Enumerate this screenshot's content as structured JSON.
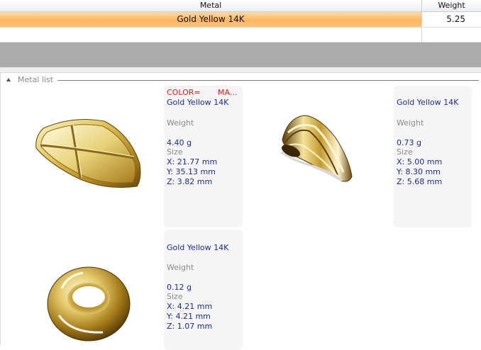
{
  "grid": {
    "columns": {
      "metal": "Metal",
      "weight": "Weight"
    },
    "selected_row": {
      "metal": "Gold Yellow 14K",
      "weight": "5.25"
    }
  },
  "metal_list": {
    "title": "Metal list",
    "items": [
      {
        "header_label": "COLOR=",
        "header_value": "MA...",
        "metal": "Gold Yellow 14K",
        "weight_label": "Weight",
        "weight": "4.40 g",
        "size_label": "Size",
        "x": "X: 21.77 mm",
        "y": "Y: 35.13 mm",
        "z": "Z: 3.82 mm",
        "thumbnail_icon": "shield-icon"
      },
      {
        "metal": "Gold Yellow 14K",
        "weight_label": "Weight",
        "weight": "0.73 g",
        "size_label": "Size",
        "x": "X: 5.00 mm",
        "y": "Y: 8.30 mm",
        "z": "Z: 5.68 mm",
        "thumbnail_icon": "bail-icon"
      },
      {
        "metal": "Gold Yellow 14K",
        "weight_label": "Weight",
        "weight": "0.12 g",
        "size_label": "Size",
        "x": "X: 4.21 mm",
        "y": "Y: 4.21 mm",
        "z": "Z: 1.07 mm",
        "thumbnail_icon": "ring-icon"
      }
    ]
  },
  "colors": {
    "selection_orange": "#ffb75e",
    "splitter_gray": "#ababab",
    "label_blue": "#1c2f8a",
    "label_red": "#e0201a"
  }
}
